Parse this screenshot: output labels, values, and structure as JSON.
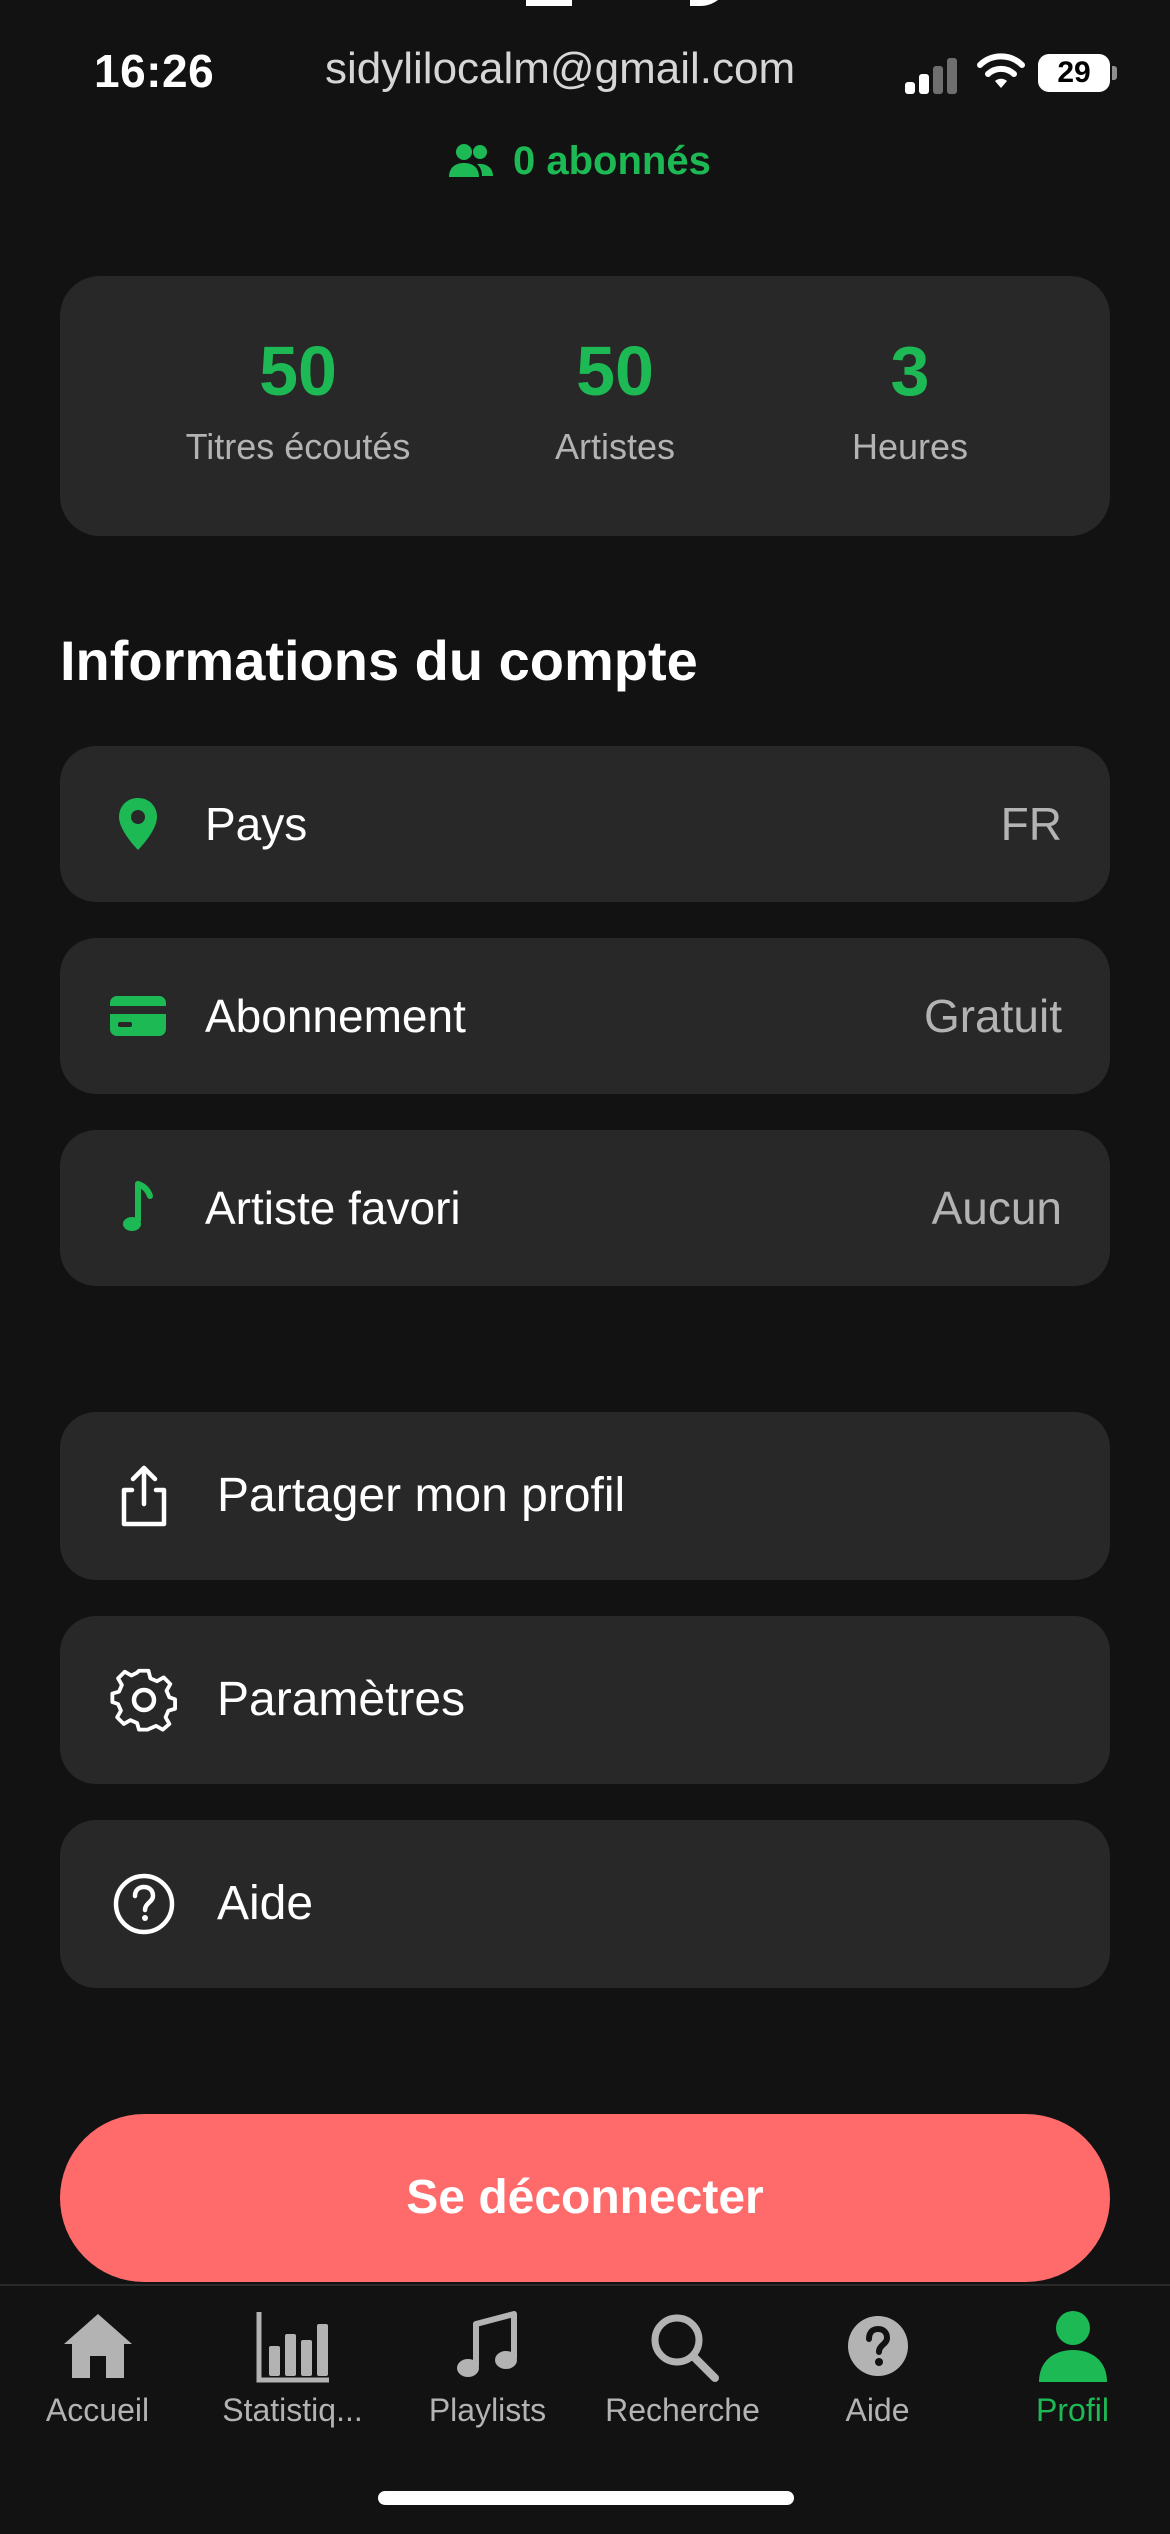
{
  "status_bar": {
    "time": "16:26",
    "email": "sidylilocalm@gmail.com",
    "battery": "29"
  },
  "profile": {
    "followers": "0 abonnés"
  },
  "stats": [
    {
      "value": "50",
      "label": "Titres écoutés"
    },
    {
      "value": "50",
      "label": "Artistes"
    },
    {
      "value": "3",
      "label": "Heures"
    }
  ],
  "account_info": {
    "title": "Informations du compte",
    "rows": [
      {
        "icon": "location-pin-icon",
        "label": "Pays",
        "value": "FR"
      },
      {
        "icon": "credit-card-icon",
        "label": "Abonnement",
        "value": "Gratuit"
      },
      {
        "icon": "music-note-icon",
        "label": "Artiste favori",
        "value": "Aucun"
      }
    ]
  },
  "actions": [
    {
      "icon": "share-icon",
      "label": "Partager mon profil"
    },
    {
      "icon": "gear-icon",
      "label": "Paramètres"
    },
    {
      "icon": "help-circle-icon",
      "label": "Aide"
    }
  ],
  "logout_label": "Se déconnecter",
  "tabs": [
    {
      "icon": "home-icon",
      "label": "Accueil",
      "active": false
    },
    {
      "icon": "bar-chart-icon",
      "label": "Statistiq...",
      "active": false
    },
    {
      "icon": "music-note-icon",
      "label": "Playlists",
      "active": false
    },
    {
      "icon": "search-icon",
      "label": "Recherche",
      "active": false
    },
    {
      "icon": "help-icon",
      "label": "Aide",
      "active": false
    },
    {
      "icon": "profile-icon",
      "label": "Profil",
      "active": true
    }
  ],
  "colors": {
    "background": "#121212",
    "card": "#282828",
    "accent": "#1db954",
    "logout": "#ff6b6b",
    "muted_text": "#b3b3b3"
  }
}
